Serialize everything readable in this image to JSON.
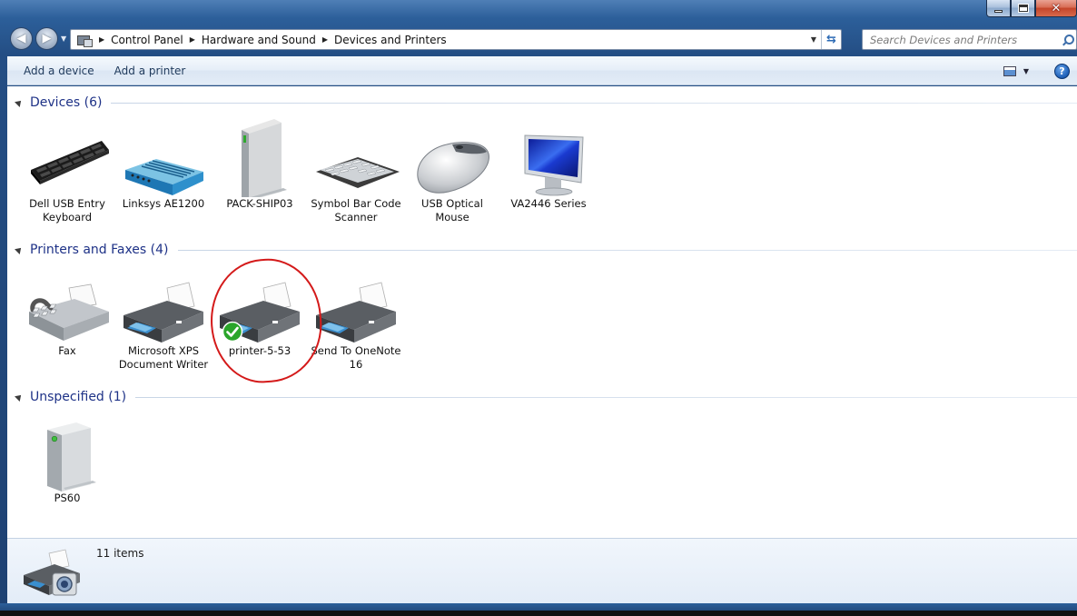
{
  "window": {
    "controls": {
      "minimize": "_",
      "maximize": "□",
      "close": "✕"
    }
  },
  "navigation": {
    "back_icon": "back-arrow-icon",
    "forward_icon": "forward-arrow-icon",
    "breadcrumbs": [
      "Control Panel",
      "Hardware and Sound",
      "Devices and Printers"
    ],
    "search_placeholder": "Search Devices and Printers"
  },
  "toolbar": {
    "add_device": "Add a device",
    "add_printer": "Add a printer",
    "help": "?"
  },
  "groups": {
    "devices": {
      "title": "Devices (6)",
      "items": [
        {
          "label": "Dell USB Entry Keyboard",
          "icon": "keyboard-icon"
        },
        {
          "label": "Linksys AE1200",
          "icon": "router-icon"
        },
        {
          "label": "PACK-SHIP03",
          "icon": "computer-tower-icon"
        },
        {
          "label": "Symbol Bar Code Scanner",
          "icon": "barcode-scanner-icon"
        },
        {
          "label": "USB Optical Mouse",
          "icon": "mouse-icon"
        },
        {
          "label": "VA2446 Series",
          "icon": "monitor-icon"
        }
      ]
    },
    "printers": {
      "title": "Printers and Faxes (4)",
      "items": [
        {
          "label": "Fax",
          "icon": "fax-icon"
        },
        {
          "label": "Microsoft XPS Document Writer",
          "icon": "printer-icon"
        },
        {
          "label": "printer-5-53",
          "icon": "printer-icon",
          "default": true
        },
        {
          "label": "Send To OneNote 16",
          "icon": "printer-icon"
        }
      ]
    },
    "unspecified": {
      "title": "Unspecified (1)",
      "items": [
        {
          "label": "PS60",
          "icon": "server-icon"
        }
      ]
    }
  },
  "details": {
    "count": "11 items",
    "icon": "devices-printers-icon"
  },
  "colors": {
    "group_title": "#1e3287",
    "annotation": "#d41a1a",
    "default_check": "#2aa52a"
  }
}
